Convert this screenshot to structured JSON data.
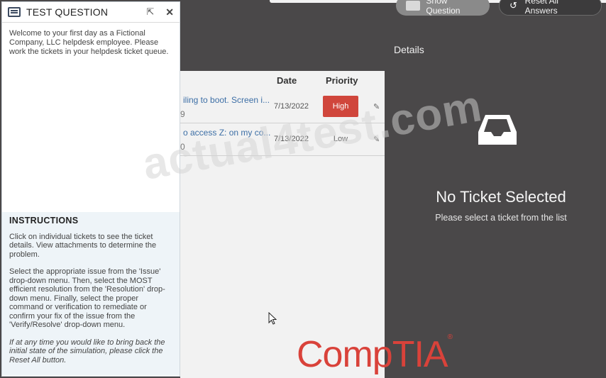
{
  "toolbar": {
    "show_question": "Show Question",
    "reset_all": "Reset All Answers"
  },
  "question": {
    "title": "TEST QUESTION",
    "intro": "Welcome to your first day as a Fictional Company, LLC helpdesk employee. Please work the tickets in your helpdesk ticket queue.",
    "instructions_title": "INSTRUCTIONS",
    "instructions": [
      "Click on individual tickets to see the ticket details. View attachments to determine the problem.",
      "Select the appropriate issue from the 'Issue' drop-down menu. Then, select the MOST efficient resolution from the 'Resolution' drop-down menu. Finally, select the proper command or verification to remediate or confirm your fix of the issue from the 'Verify/Resolve' drop-down menu."
    ],
    "note": "If at any time you would like to bring back the initial state of the simulation, please click the Reset All button."
  },
  "ticket_list": {
    "columns": {
      "date": "Date",
      "priority": "Priority"
    },
    "tickets": [
      {
        "description": "iling to boot. Screen i...",
        "number": "9",
        "date": "7/13/2022",
        "priority": "High",
        "priority_color": "#d0463c"
      },
      {
        "description": "o access Z: on my co...",
        "number": "0",
        "date": "7/13/2022",
        "priority": "Low",
        "priority_color": ""
      }
    ]
  },
  "details": {
    "label": "Details",
    "empty_title": "No Ticket Selected",
    "empty_subtitle": "Please select a ticket from the list"
  },
  "watermark": "actual4test.com",
  "logo": {
    "text": "CompTIA",
    "color": "#d9423a"
  }
}
